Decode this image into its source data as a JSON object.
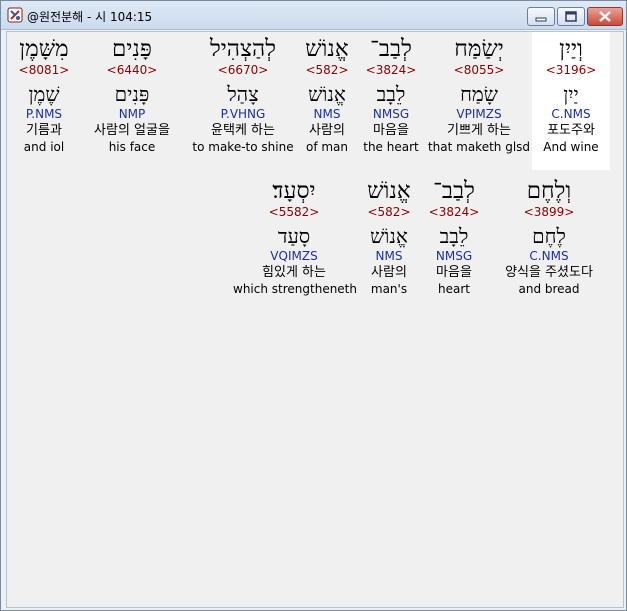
{
  "window": {
    "title": "@원전분해 - 시 104:15"
  },
  "row1": [
    {
      "hebrew": "וְיַיִן",
      "strong": "<3196>",
      "lemma": "יַיִן",
      "morph": "C.NMS",
      "korean": "포도주와",
      "english": "And wine"
    },
    {
      "hebrew": "יְשַׂמַּח",
      "strong": "<8055>",
      "lemma": "שָׂמַח",
      "morph": "VPIMZS",
      "korean": "기쁘게 하는",
      "english": "that maketh glsd"
    },
    {
      "hebrew": "לְבַב־",
      "strong": "<3824>",
      "lemma": "לֵבָב",
      "morph": "NMSG",
      "korean": "마음을",
      "english": "the heart"
    },
    {
      "hebrew": "אֱנוֹשׁ",
      "strong": "<582>",
      "lemma": "אֱנוֹשׁ",
      "morph": "NMS",
      "korean": "사람의",
      "english": "of man"
    },
    {
      "hebrew": "לְהַצְהִיל",
      "strong": "<6670>",
      "lemma": "צָהַל",
      "morph": "P.VHNG",
      "korean": "윤택케 하는",
      "english": "to make-to shine"
    },
    {
      "hebrew": "פָּנִים",
      "strong": "<6440>",
      "lemma": "פָּנִים",
      "morph": "NMP",
      "korean": "사람의 얼굴을",
      "english": "his face"
    },
    {
      "hebrew": "מִשָּׁמֶן",
      "strong": "<8081>",
      "lemma": "שֶׁמֶן",
      "morph": "P.NMS",
      "korean": "기름과",
      "english": "and iol"
    }
  ],
  "row2": [
    {
      "hebrew": "וְלֶחֶם",
      "strong": "<3899>",
      "lemma": "לֶחֶם",
      "morph": "C.NMS",
      "korean": "양식을 주셨도다",
      "english": "and bread"
    },
    {
      "hebrew": "לְבַב־",
      "strong": "<3824>",
      "lemma": "לֵבָב",
      "morph": "NMSG",
      "korean": "마음을",
      "english": "heart"
    },
    {
      "hebrew": "אֱנוֹשׁ",
      "strong": "<582>",
      "lemma": "אֱנוֹשׁ",
      "morph": "NMS",
      "korean": "사람의",
      "english": "man's"
    },
    {
      "hebrew": "יִסְעָד׃",
      "strong": "<5582>",
      "lemma": "סָעַד",
      "morph": "VQIMZS",
      "korean": "힘있게 하는",
      "english": "which strengtheneth"
    }
  ],
  "colors": {
    "strong": "#8b0000",
    "morph": "#1a2fa6",
    "highlight": "#ffffff"
  },
  "icons": {
    "app": "cross-tool-icon",
    "minimize": "minimize-icon",
    "maximize": "maximize-icon",
    "close": "close-icon"
  }
}
